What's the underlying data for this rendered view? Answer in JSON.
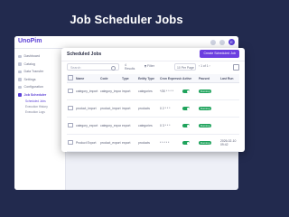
{
  "banner": {
    "title": "Job Scheduler Jobs"
  },
  "app": {
    "logo": "UnoPim",
    "user_initial": "E",
    "sidebar": [
      {
        "label": "Dashboard"
      },
      {
        "label": "Catalog"
      },
      {
        "label": "Data Transfer"
      },
      {
        "label": "Settings"
      },
      {
        "label": "Configuration"
      },
      {
        "label": "Job Scheduler"
      }
    ],
    "sidebar_sub": [
      {
        "label": "Scheduled Jobs"
      },
      {
        "label": "Execution History"
      },
      {
        "label": "Execution Logs"
      }
    ]
  },
  "card": {
    "title": "Scheduled Jobs",
    "create_button": "Create Scheduled Job",
    "search_placeholder": "Search",
    "results": "4 Results",
    "filter": "Filter",
    "per_page": "10 Per Page",
    "pagination": "1 of 1",
    "columns": [
      "",
      "Name",
      "Code",
      "Type",
      "Entity Type",
      "Cron Expression",
      "Active",
      "Paused",
      "Last Run"
    ],
    "rows": [
      {
        "name": "category_import",
        "code": "category_import",
        "type": "import",
        "entity": "categories",
        "cron": "*/30 * * * *",
        "active": true,
        "paused": "Running",
        "last_run": ""
      },
      {
        "name": "product_import",
        "code": "product_import",
        "type": "import",
        "entity": "products",
        "cron": "0 2 * * *",
        "active": true,
        "paused": "Running",
        "last_run": ""
      },
      {
        "name": "category_export",
        "code": "category_export",
        "type": "export",
        "entity": "categories",
        "cron": "0 3 * * *",
        "active": true,
        "paused": "Running",
        "last_run": ""
      },
      {
        "name": "Product Export",
        "code": "product_export",
        "type": "export",
        "entity": "products",
        "cron": "* * * * *",
        "active": true,
        "paused": "Running",
        "last_run": "2026-02-10 09:42"
      }
    ]
  },
  "colors": {
    "background": "#222a4e",
    "accent": "#6c3fe0",
    "success": "#1fa35c"
  }
}
